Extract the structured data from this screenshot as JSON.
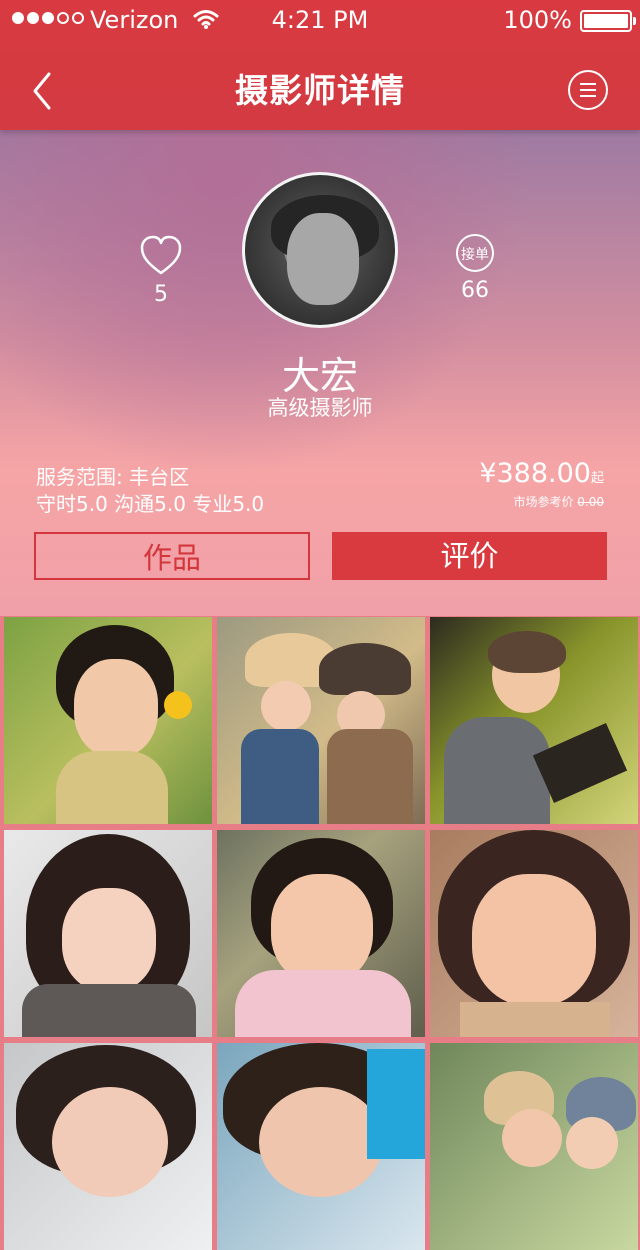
{
  "status": {
    "carrier": "Verizon",
    "time": "4:21 PM",
    "battery": "100%"
  },
  "nav": {
    "back_icon": "chevron-left-icon",
    "title": "摄影师详情",
    "menu_icon": "menu-circle-icon"
  },
  "profile": {
    "likes": "5",
    "orders_label": "接单",
    "orders_count": "66",
    "name": "大宏",
    "level": "高级摄影师",
    "service_area": "服务范围: 丰台区",
    "ratings": "守时5.0  沟通5.0  专业5.0",
    "price": "¥388.00",
    "price_suffix": "起",
    "market_label": "市场参考价",
    "market_price": "0.00"
  },
  "tabs": {
    "works": "作品",
    "review": "评价"
  },
  "colors": {
    "primary": "#d93a41",
    "light": "#ffffff"
  },
  "gallery": {
    "items": [
      "portrait-1",
      "portrait-2",
      "portrait-3",
      "portrait-4",
      "portrait-5",
      "portrait-6",
      "portrait-7",
      "portrait-8",
      "portrait-9"
    ]
  }
}
